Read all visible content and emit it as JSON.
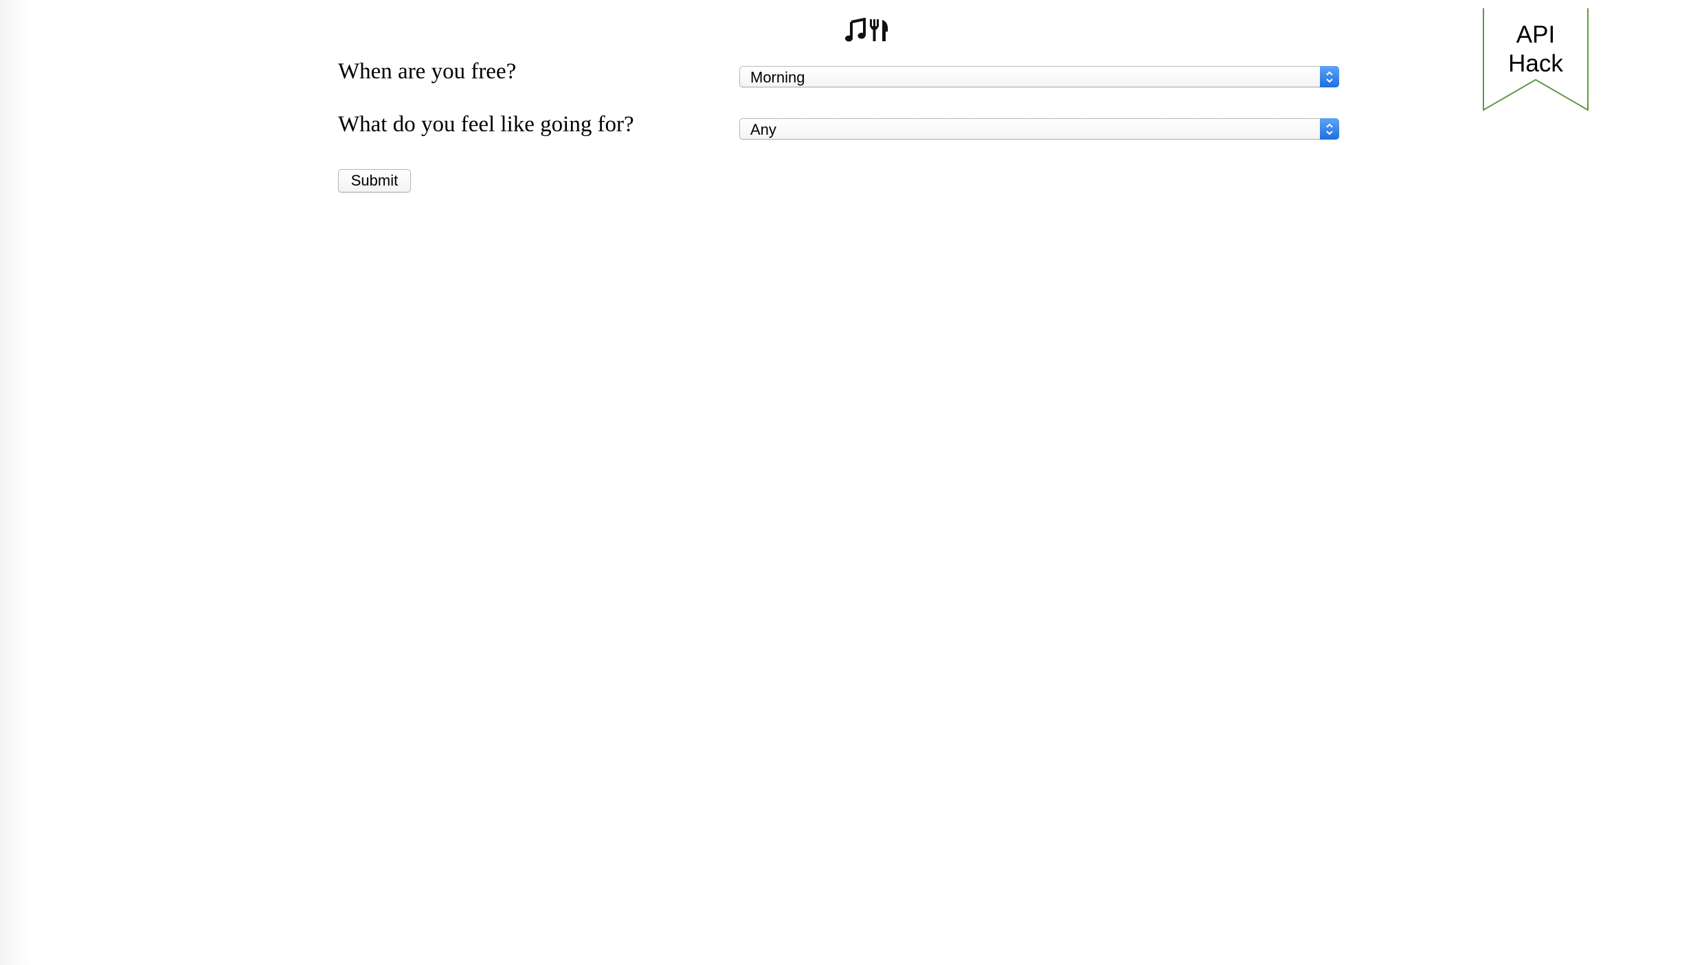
{
  "header": {
    "icons": [
      "music-note-icon",
      "fork-knife-icon"
    ]
  },
  "form": {
    "question_free": "When are you free?",
    "select_free_value": "Morning",
    "question_feel": "What do you feel like going for?",
    "select_feel_value": "Any",
    "submit_label": "Submit"
  },
  "ribbon": {
    "line1": "API",
    "line2": "Hack",
    "border_color": "#5b9a3c"
  },
  "colors": {
    "select_arrow": "#2f7de8"
  }
}
